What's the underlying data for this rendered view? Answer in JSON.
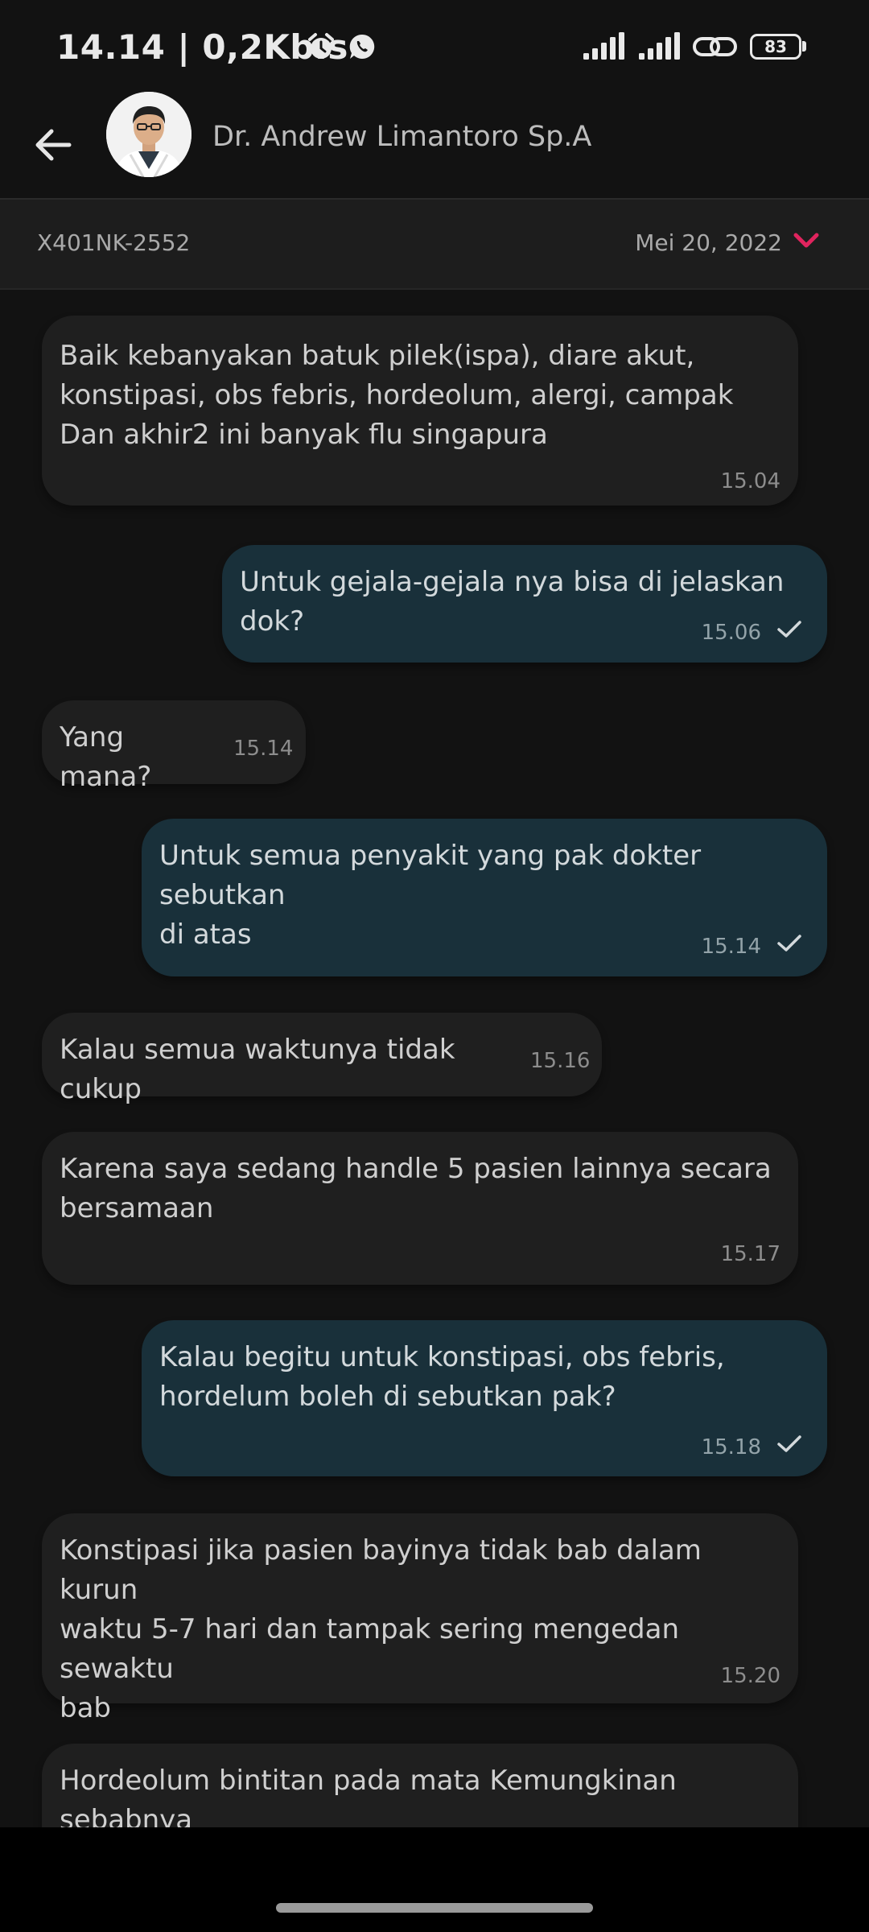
{
  "status_bar": {
    "time_speed": "14.14 | 0,2Kb.s",
    "icons": [
      "alarm-icon",
      "whatsapp-icon",
      "signal-icon",
      "signal-icon",
      "link-icon",
      "battery-icon"
    ],
    "battery_level": "83"
  },
  "header": {
    "contact_name": "Dr. Andrew Limantoro Sp.A",
    "back_icon": "arrow-left-icon"
  },
  "consultation": {
    "id": "X401NK-2552",
    "date": "Mei 20, 2022",
    "chevron_color": "#e0245e"
  },
  "messages": [
    {
      "direction": "in",
      "text": "Baik kebanyakan batuk pilek(ispa), diare akut,\nkonstipasi, obs febris, hordeolum, alergi, campak\nDan akhir2 ini banyak flu singapura",
      "time": "15.04"
    },
    {
      "direction": "out",
      "text": "Untuk gejala-gejala nya bisa di jelaskan dok?",
      "time": "15.06",
      "status": "sent"
    },
    {
      "direction": "in",
      "text": "Yang mana?",
      "time": "15.14"
    },
    {
      "direction": "out",
      "text": "Untuk semua penyakit yang pak dokter sebutkan\ndi atas",
      "time": "15.14",
      "status": "sent"
    },
    {
      "direction": "in",
      "text": "Kalau semua waktunya tidak cukup",
      "time": "15.16"
    },
    {
      "direction": "in",
      "text": "Karena saya sedang handle 5 pasien lainnya secara\nbersamaan",
      "time": "15.17"
    },
    {
      "direction": "out",
      "text": "Kalau begitu untuk konstipasi, obs febris,\nhordelum boleh di sebutkan pak?",
      "time": "15.18",
      "status": "sent"
    },
    {
      "direction": "in",
      "text": "Konstipasi jika pasien bayinya tidak bab dalam kurun\nwaktu 5-7 hari dan tampak sering mengedan sewaktu\nbab",
      "time": "15.20"
    },
    {
      "direction": "in",
      "text": "Hordeolum bintitan pada mata  Kemungkinan sebabnya\nakibat sering terpapar virus atau bakteri dari lingkungan"
    }
  ],
  "colors": {
    "incoming_bubble": "#1f1f1f",
    "outgoing_bubble": "#19303a",
    "accent": "#e0245e"
  }
}
